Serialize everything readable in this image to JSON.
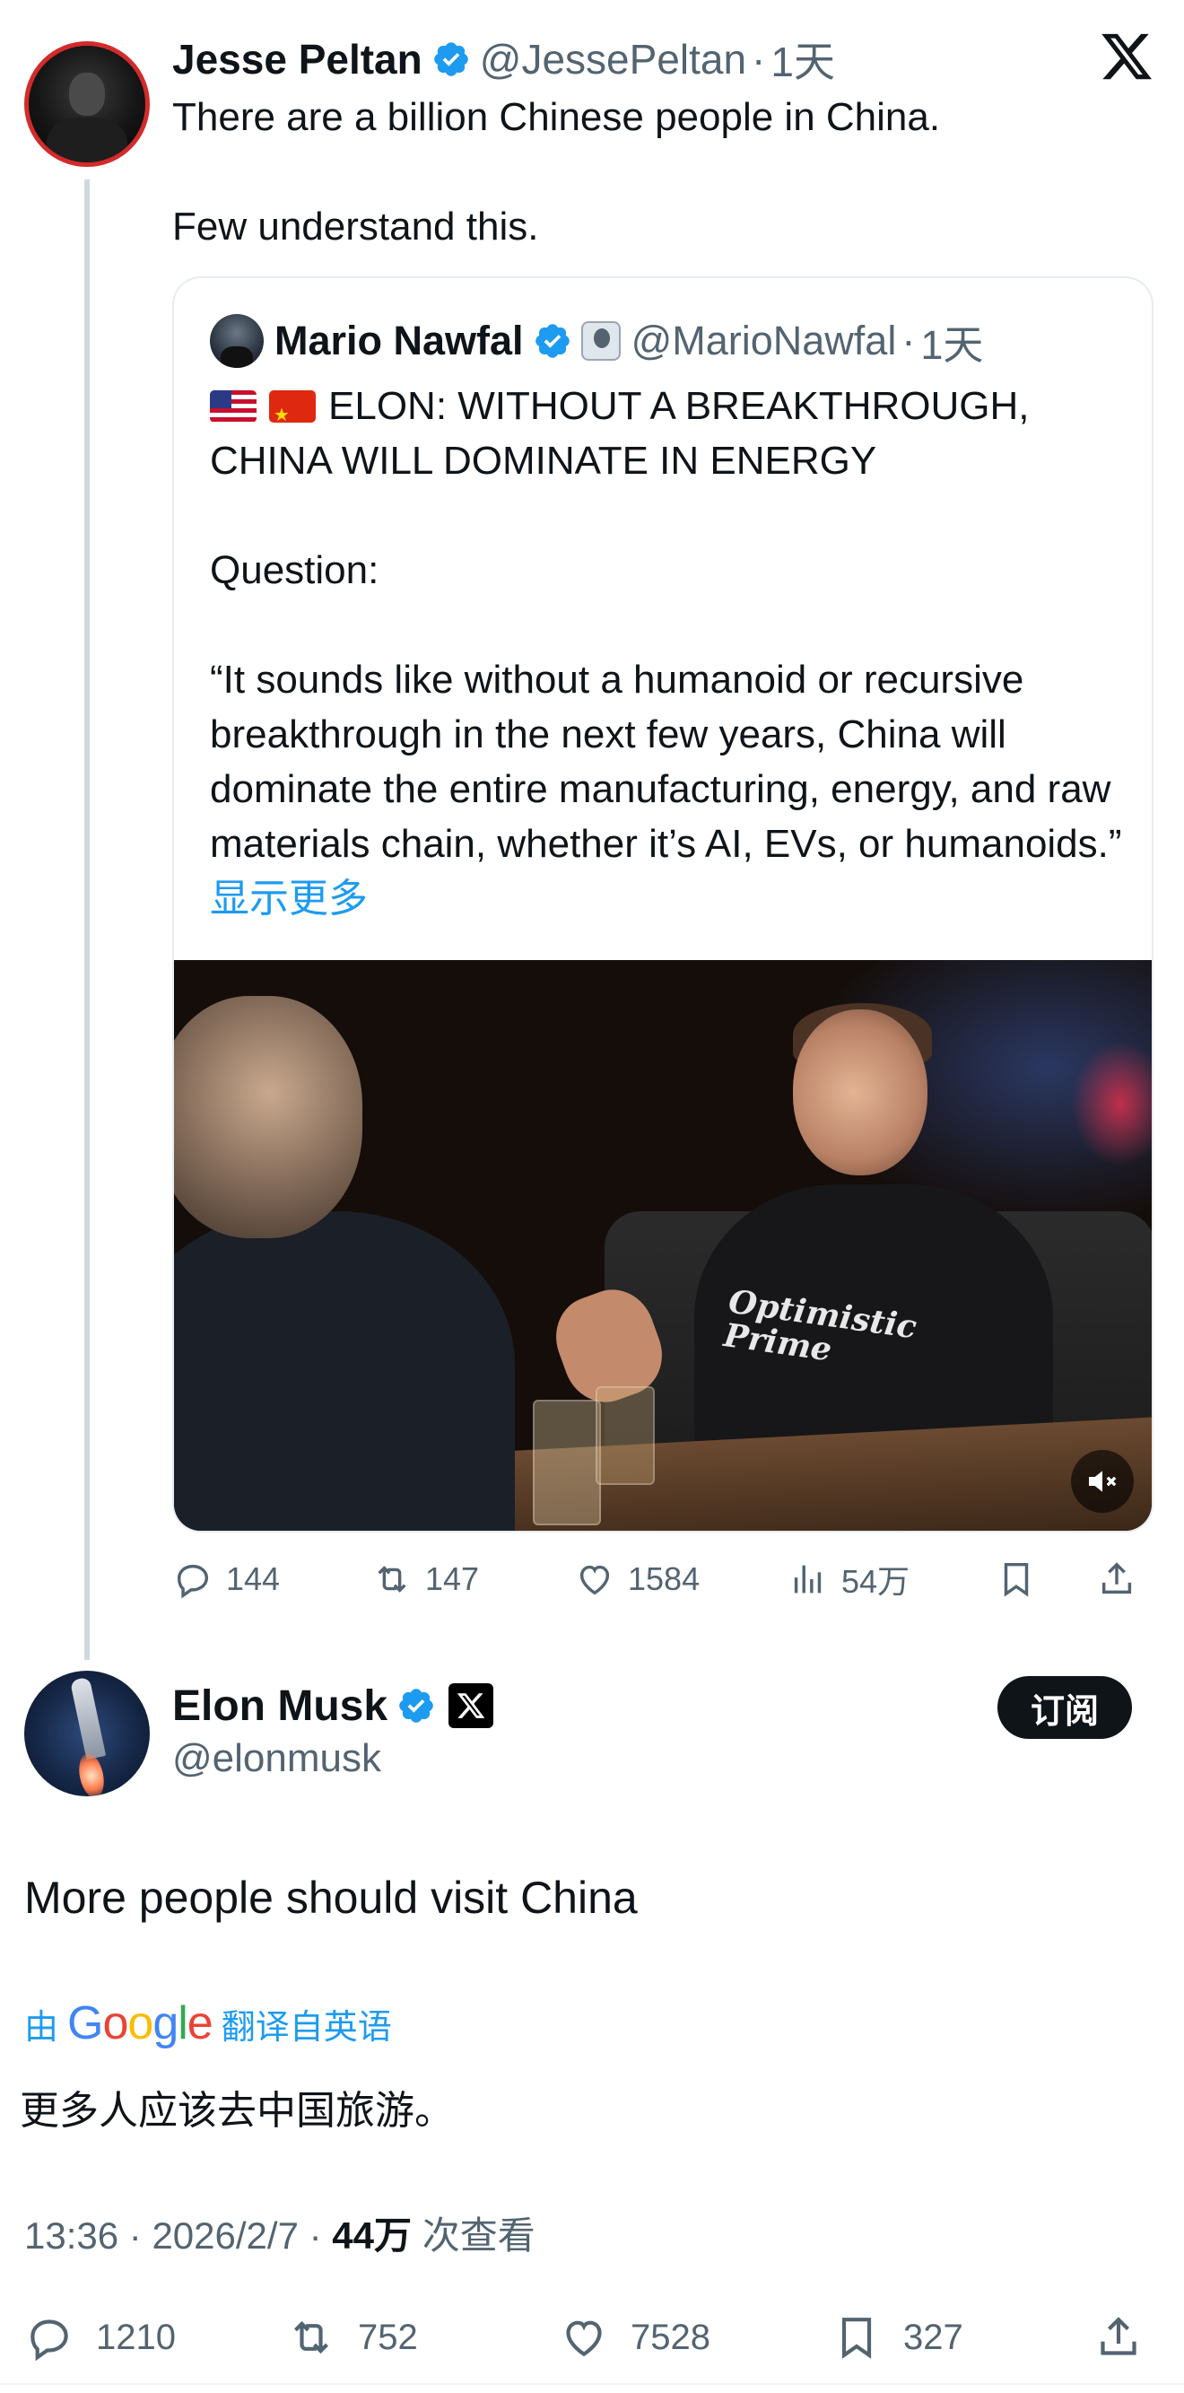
{
  "parent_tweet": {
    "author_name": "Jesse Peltan",
    "handle": "@JessePeltan",
    "separator": "·",
    "time": "1天",
    "text": "There are a billion Chinese people in China.\n\nFew understand this.",
    "quoted_tweet": {
      "author_name": "Mario Nawfal",
      "handle": "@MarioNawfal",
      "separator": "·",
      "time": "1天",
      "headline": "ELON: WITHOUT A BREAKTHROUGH, CHINA WILL DOMINATE IN ENERGY",
      "body": "\n\nQuestion:\n\n“It sounds like without a humanoid or recursive breakthrough in the next few years, China will dominate the entire manufacturing, energy, and raw materials chain, whether it’s AI, EVs, or humanoids.” ",
      "show_more": "显示更多",
      "video_shirt_text": "Optimistic Prime"
    },
    "actions": {
      "replies": "144",
      "reposts": "147",
      "likes": "1584",
      "views": "54万"
    }
  },
  "main_tweet": {
    "author_name": "Elon Musk",
    "handle": "@elonmusk",
    "subscribe_label": "订阅",
    "text": "More people should visit China",
    "translation": {
      "prefix": "由",
      "provider": "Google",
      "suffix": "翻译自英语",
      "text": "更多人应该去中国旅游。"
    },
    "meta": {
      "time": "13:36",
      "sep1": "·",
      "date": "2026/2/7",
      "sep2": "·",
      "views": "44万",
      "views_label": "次查看"
    },
    "actions": {
      "replies": "1210",
      "reposts": "752",
      "likes": "7528",
      "bookmarks": "327"
    }
  },
  "colors": {
    "accent": "#1d9bf0",
    "text_primary": "#0f1419",
    "text_secondary": "#536471",
    "avatar_border": "#d32b2b"
  },
  "icons": [
    "verified-badge-icon",
    "x-logo-icon",
    "mute-icon",
    "reply-icon",
    "repost-icon",
    "like-icon",
    "views-icon",
    "bookmark-icon",
    "share-icon"
  ]
}
